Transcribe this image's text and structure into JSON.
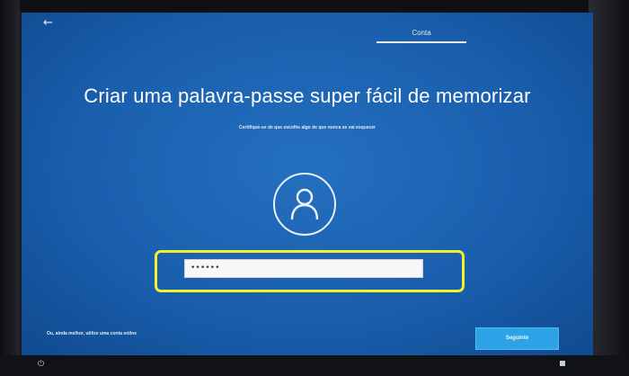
{
  "window": {
    "back_icon": "back-arrow-icon",
    "section_label": "Conta"
  },
  "main": {
    "title": "Criar uma palavra-passe super fácil de memorizar",
    "subtitle": "Certifique-se de que escolhe algo de que nunca se vai esquecer",
    "avatar_icon": "user-icon",
    "password_value": "••••••"
  },
  "footer": {
    "online_account_link": "Ou, ainda melhor, utilize uma conta online",
    "next_label": "Seguinte"
  },
  "colors": {
    "screen_blue": "#1a5fae",
    "button_blue": "#2ba3e6",
    "highlight_yellow": "#f6ef2e"
  }
}
